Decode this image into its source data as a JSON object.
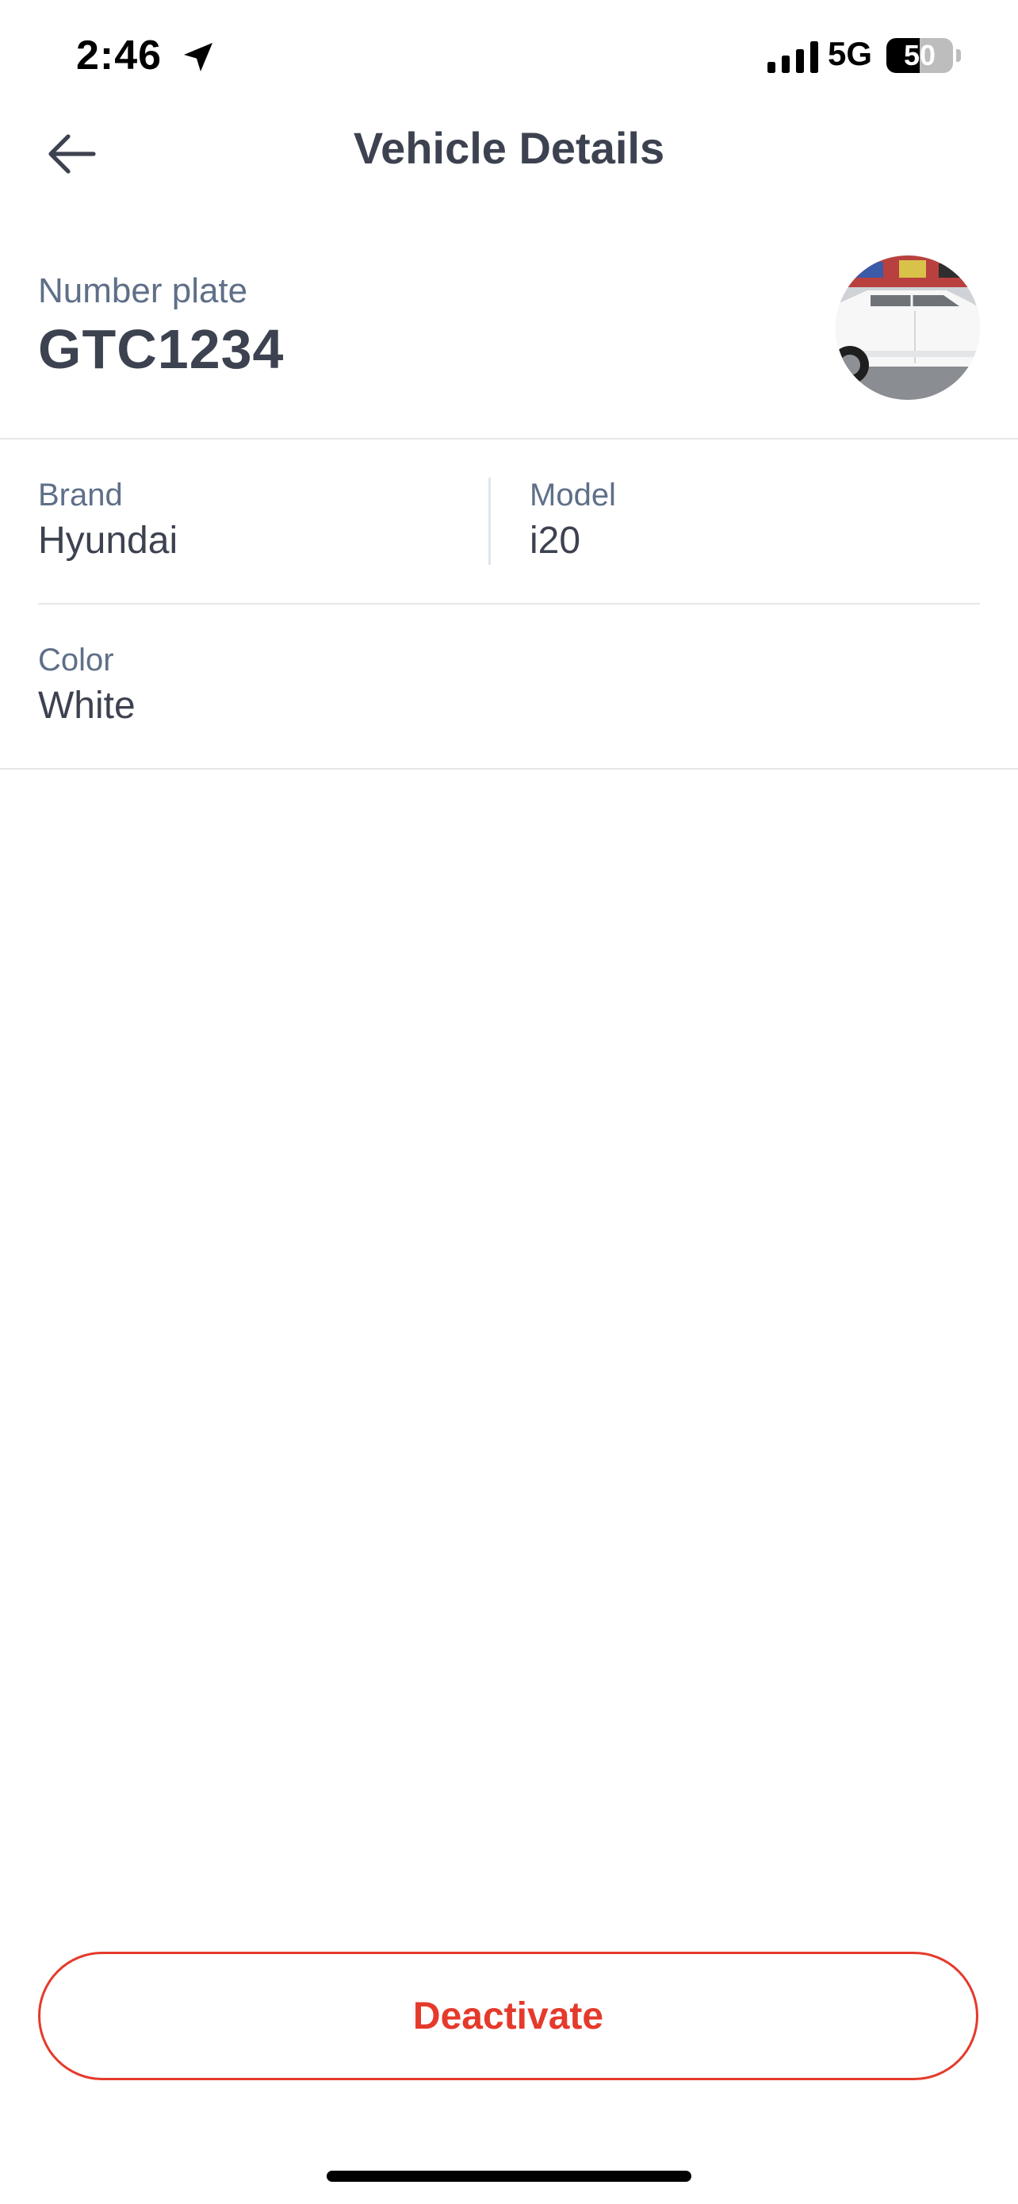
{
  "status_bar": {
    "time": "2:46",
    "network": "5G",
    "battery_percent": "50",
    "battery_level": 0.5,
    "location_icon": "location-arrow-icon",
    "signal_icon": "cellular-signal-icon"
  },
  "header": {
    "title": "Vehicle Details",
    "back_icon": "arrow-left-icon"
  },
  "plate": {
    "label": "Number plate",
    "value": "GTC1234"
  },
  "details": {
    "brand": {
      "label": "Brand",
      "value": "Hyundai"
    },
    "model": {
      "label": "Model",
      "value": "i20"
    },
    "color": {
      "label": "Color",
      "value": "White"
    }
  },
  "actions": {
    "deactivate_label": "Deactivate"
  },
  "colors": {
    "text_primary": "#3d4250",
    "text_label": "#5f6f88",
    "danger": "#e53a2b",
    "divider": "#e6e7ea"
  }
}
